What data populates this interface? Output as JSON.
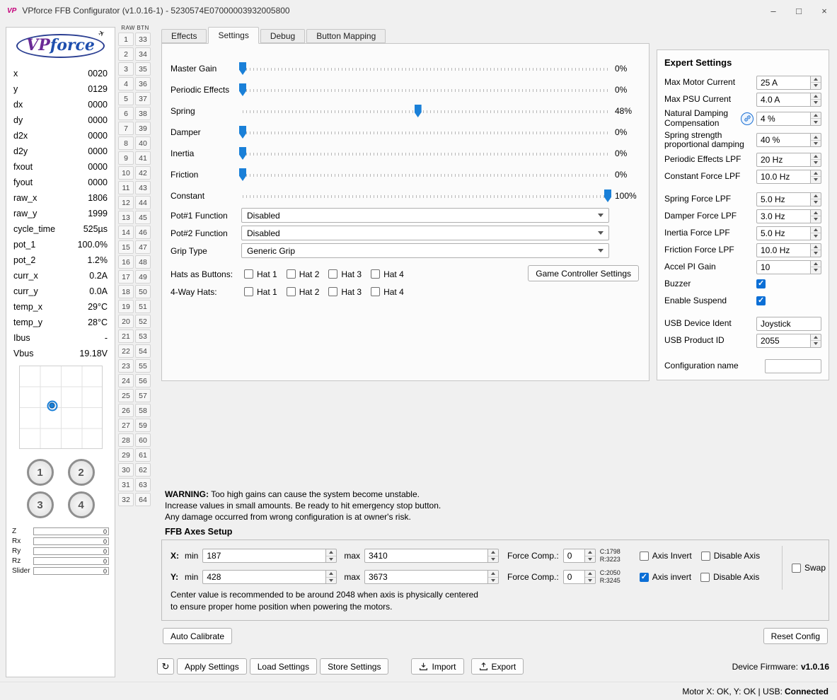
{
  "window": {
    "icon": "VP",
    "title": "VPforce FFB Configurator (v1.0.16-1) - 5230574E07000003932005800",
    "minimize": "–",
    "maximize": "□",
    "close": "×"
  },
  "logo": {
    "vp": "VP",
    "force": "force"
  },
  "telemetry": {
    "rows": [
      {
        "label": "x",
        "value": "0020"
      },
      {
        "label": "y",
        "value": "0129"
      },
      {
        "label": "dx",
        "value": "0000"
      },
      {
        "label": "dy",
        "value": "0000"
      },
      {
        "label": "d2x",
        "value": "0000"
      },
      {
        "label": "d2y",
        "value": "0000"
      },
      {
        "label": "fxout",
        "value": "0000"
      },
      {
        "label": "fyout",
        "value": "0000"
      },
      {
        "label": "raw_x",
        "value": "1806"
      },
      {
        "label": "raw_y",
        "value": "1999"
      },
      {
        "label": "cycle_time",
        "value": "525µs"
      },
      {
        "label": "pot_1",
        "value": "100.0%"
      },
      {
        "label": "pot_2",
        "value": "1.2%"
      },
      {
        "label": "curr_x",
        "value": "0.2A"
      },
      {
        "label": "curr_y",
        "value": "0.0A"
      },
      {
        "label": "temp_x",
        "value": "29°C"
      },
      {
        "label": "temp_y",
        "value": "28°C"
      },
      {
        "label": "Ibus",
        "value": "-"
      },
      {
        "label": "Vbus",
        "value": "19.18V"
      }
    ],
    "buttons": [
      "1",
      "2",
      "3",
      "4"
    ],
    "axes": [
      {
        "label": "Z",
        "value": "0",
        "fill": 55
      },
      {
        "label": "Rx",
        "value": "0",
        "fill": 0
      },
      {
        "label": "Ry",
        "value": "0",
        "fill": 0
      },
      {
        "label": "Rz",
        "value": "0",
        "fill": 0
      },
      {
        "label": "Slider",
        "value": "0",
        "fill": 0
      }
    ]
  },
  "raw_btn": {
    "header": "RAW BTN",
    "rows": [
      {
        "l": "1",
        "r": "33"
      },
      {
        "l": "2",
        "r": "34"
      },
      {
        "l": "3",
        "r": "35"
      },
      {
        "l": "4",
        "r": "36"
      },
      {
        "l": "5",
        "r": "37"
      },
      {
        "l": "6",
        "r": "38"
      },
      {
        "l": "7",
        "r": "39"
      },
      {
        "l": "8",
        "r": "40"
      },
      {
        "l": "9",
        "r": "41"
      },
      {
        "l": "10",
        "r": "42"
      },
      {
        "l": "11",
        "r": "43"
      },
      {
        "l": "12",
        "r": "44"
      },
      {
        "l": "13",
        "r": "45"
      },
      {
        "l": "14",
        "r": "46"
      },
      {
        "l": "15",
        "r": "47"
      },
      {
        "l": "16",
        "r": "48"
      },
      {
        "l": "17",
        "r": "49"
      },
      {
        "l": "18",
        "r": "50"
      },
      {
        "l": "19",
        "r": "51"
      },
      {
        "l": "20",
        "r": "52"
      },
      {
        "l": "21",
        "r": "53"
      },
      {
        "l": "22",
        "r": "54"
      },
      {
        "l": "23",
        "r": "55"
      },
      {
        "l": "24",
        "r": "56"
      },
      {
        "l": "25",
        "r": "57"
      },
      {
        "l": "26",
        "r": "58"
      },
      {
        "l": "27",
        "r": "59"
      },
      {
        "l": "28",
        "r": "60"
      },
      {
        "l": "29",
        "r": "61"
      },
      {
        "l": "30",
        "r": "62"
      },
      {
        "l": "31",
        "r": "63"
      },
      {
        "l": "32",
        "r": "64"
      }
    ]
  },
  "tabs": [
    "Effects",
    "Settings",
    "Debug",
    "Button Mapping"
  ],
  "settings": {
    "sliders": [
      {
        "label": "Master Gain",
        "value": "0%",
        "pos": 0
      },
      {
        "label": "Periodic Effects",
        "value": "0%",
        "pos": 0
      },
      {
        "label": "Spring",
        "value": "48%",
        "pos": 48
      },
      {
        "label": "Damper",
        "value": "0%",
        "pos": 0
      },
      {
        "label": "Inertia",
        "value": "0%",
        "pos": 0
      },
      {
        "label": "Friction",
        "value": "0%",
        "pos": 0
      },
      {
        "label": "Constant",
        "value": "100%",
        "pos": 100
      }
    ],
    "selects": [
      {
        "label": "Pot#1 Function",
        "value": "Disabled"
      },
      {
        "label": "Pot#2 Function",
        "value": "Disabled"
      },
      {
        "label": "Grip Type",
        "value": "Generic Grip"
      }
    ],
    "hats_buttons_label": "Hats as Buttons:",
    "four_way_label": "4-Way Hats:",
    "hat_options": [
      "Hat 1",
      "Hat 2",
      "Hat 3",
      "Hat 4"
    ],
    "game_controller_button": "Game Controller Settings"
  },
  "expert": {
    "title": "Expert Settings",
    "rows": [
      {
        "label": "Max Motor Current",
        "value": "25 A"
      },
      {
        "label": "Max PSU Current",
        "value": "4.0 A"
      },
      {
        "label1": "Natural Damping",
        "label2": "Compensation",
        "value": "4 %"
      },
      {
        "label1": "Spring strength",
        "label2": "proportional damping",
        "value": "40 %"
      },
      {
        "label": "Periodic Effects LPF",
        "value": "20 Hz"
      },
      {
        "label": "Constant Force LPF",
        "value": "10.0 Hz"
      },
      {
        "label": "Spring Force LPF",
        "value": "5.0 Hz"
      },
      {
        "label": "Damper Force LPF",
        "value": "3.0 Hz"
      },
      {
        "label": "Inertia Force LPF",
        "value": "5.0 Hz"
      },
      {
        "label": "Friction Force LPF",
        "value": "10.0 Hz"
      },
      {
        "label": "Accel PI Gain",
        "value": "10"
      },
      {
        "label": "Buzzer",
        "checked": true
      },
      {
        "label": "Enable Suspend",
        "checked": true
      },
      {
        "label": "USB Device Ident",
        "value": "Joystick"
      },
      {
        "label": "USB Product ID",
        "value": "2055"
      },
      {
        "label": "Configuration name",
        "value": ""
      }
    ]
  },
  "warning": {
    "bold": "WARNING:",
    "line1": " Too high gains can cause the system become unstable.",
    "line2": "Increase values in small amounts. Be ready to hit emergency stop button.",
    "line3": "Any damage occurred from wrong configuration is at owner's risk."
  },
  "ffb": {
    "title": "FFB Axes Setup",
    "rows": [
      {
        "axis": "X:",
        "min_label": "min",
        "min": "187",
        "max_label": "max",
        "max": "3410",
        "fc_label": "Force Comp.:",
        "fc": "0",
        "center": "C:1798",
        "range": "R:3223",
        "invert_label": "Axis Invert",
        "invert_checked": false,
        "disable_label": "Disable Axis",
        "disable_checked": false
      },
      {
        "axis": "Y:",
        "min_label": "min",
        "min": "428",
        "max_label": "max",
        "max": "3673",
        "fc_label": "Force Comp.:",
        "fc": "0",
        "center": "C:2050",
        "range": "R:3245",
        "invert_label": "Axis invert",
        "invert_checked": true,
        "disable_label": "Disable Axis",
        "disable_checked": false
      }
    ],
    "swap_label": "Swap",
    "swap_checked": false,
    "note1": "Center value is recommended to be around 2048 when axis is physically centered",
    "note2": "to ensure proper home position when powering the motors."
  },
  "buttons": {
    "auto_calibrate": "Auto Calibrate",
    "reset_config": "Reset Config",
    "refresh": "↻",
    "apply": "Apply Settings",
    "load": "Load Settings",
    "store": "Store Settings",
    "import": "Import",
    "export": "Export"
  },
  "footer": {
    "firmware_label": "Device Firmware:",
    "firmware_value": "v1.0.16"
  },
  "statusbar": {
    "left": "Motor X: OK, Y: OK | USB: ",
    "connected": "Connected"
  }
}
